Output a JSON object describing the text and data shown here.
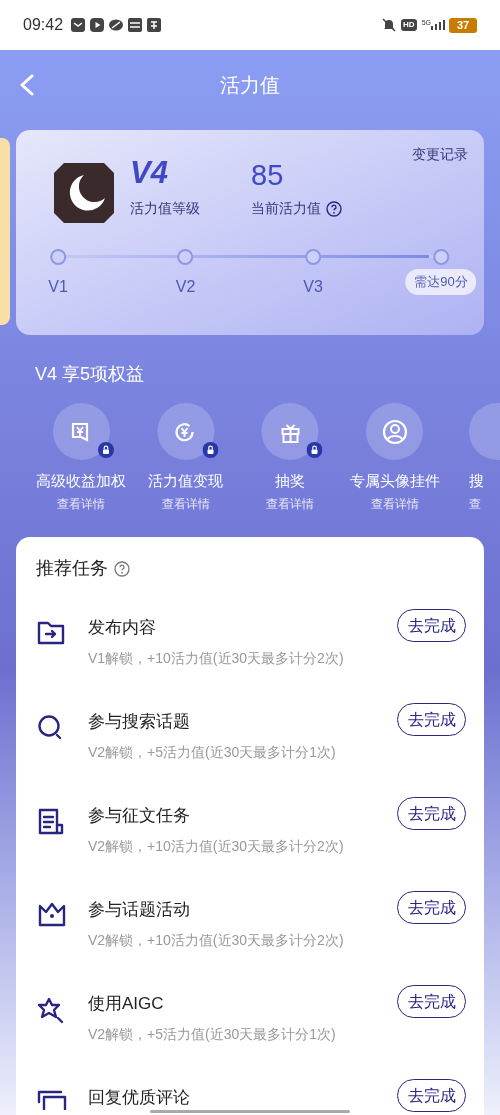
{
  "status_bar": {
    "time": "09:42",
    "network": "5G",
    "hd": "HD",
    "battery": "37"
  },
  "header": {
    "title": "活力值"
  },
  "level_card": {
    "level": "V4",
    "level_label": "活力值等级",
    "score": "85",
    "score_label": "当前活力值",
    "history_link": "变更记录",
    "progress": {
      "level": 0.97,
      "nodes": [
        "V1",
        "V2",
        "V3"
      ],
      "next_badge": "需达90分"
    }
  },
  "benefits": {
    "title": "V4 享5项权益",
    "items": [
      {
        "name": "高级收益加权",
        "link": "查看详情",
        "locked": true
      },
      {
        "name": "活力值变现",
        "link": "查看详情",
        "locked": true
      },
      {
        "name": "抽奖",
        "link": "查看详情",
        "locked": true
      },
      {
        "name": "专属头像挂件",
        "link": "查看详情",
        "locked": false
      },
      {
        "name": "搜",
        "link": "查"
      }
    ]
  },
  "tasks": {
    "title": "推荐任务",
    "items": [
      {
        "title": "发布内容",
        "desc": "V1解锁，+10活力值(近30天最多计分2次)",
        "button": "去完成"
      },
      {
        "title": "参与搜索话题",
        "desc": "V2解锁，+5活力值(近30天最多计分1次)",
        "button": "去完成"
      },
      {
        "title": "参与征文任务",
        "desc": "V2解锁，+10活力值(近30天最多计分2次)",
        "button": "去完成"
      },
      {
        "title": "参与话题活动",
        "desc": "V2解锁，+10活力值(近30天最多计分2次)",
        "button": "去完成"
      },
      {
        "title": "使用AIGC",
        "desc": "V2解锁，+5活力值(近30天最多计分1次)",
        "button": "去完成"
      },
      {
        "title": "回复优质评论",
        "button": "去完成"
      }
    ]
  }
}
